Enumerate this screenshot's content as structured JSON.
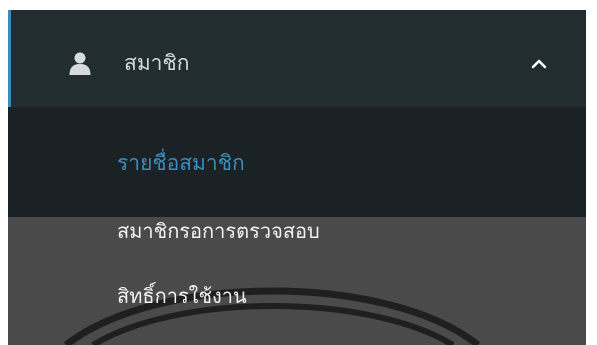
{
  "sidebar": {
    "member_menu": {
      "label": "สมาชิก",
      "icon": "user-icon",
      "toggle_icon": "chevron-up-icon",
      "expanded": true
    },
    "submenu": [
      {
        "label": "รายชื่อสมาชิก",
        "active": true
      },
      {
        "label": "สมาชิกรอการตรวจสอบ",
        "active": false
      },
      {
        "label": "สิทธิ์การใช้งาน",
        "active": false
      }
    ]
  },
  "colors": {
    "sidebar_bg": "#222d32",
    "active_row_bg": "#1a2226",
    "submenu_bg": "#4a4a4a",
    "accent": "#3c8dbc",
    "text_light": "#d5dbde"
  }
}
